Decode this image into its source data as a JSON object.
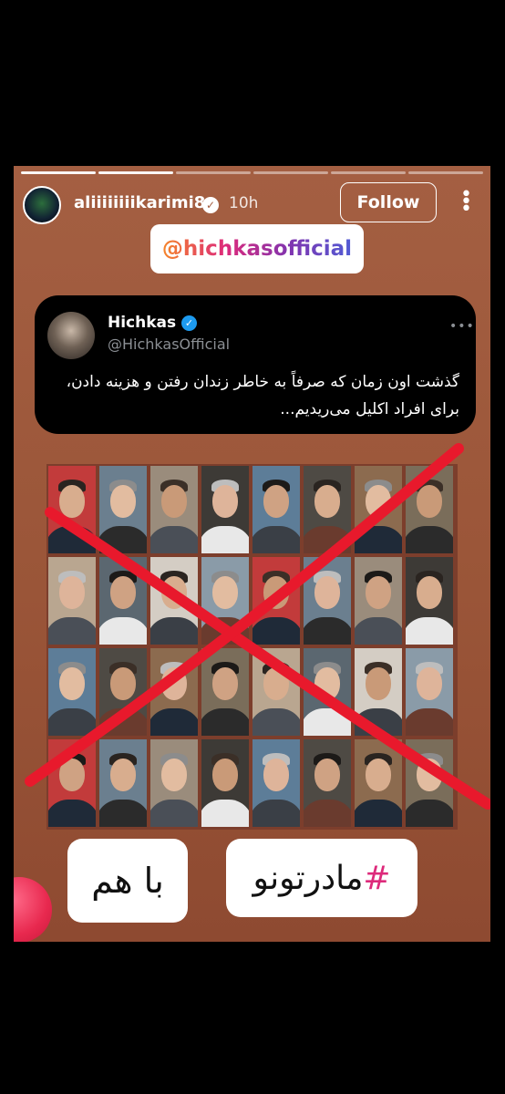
{
  "story": {
    "username": "aliiiiiiiikarimi8",
    "time": "10h",
    "follow_label": "Follow",
    "verified_icon": "verified-badge-icon",
    "progress_total": 6,
    "progress_done": 2
  },
  "mention": {
    "text": "@hichkasofficial"
  },
  "tweet": {
    "name": "Hichkas",
    "handle": "@HichkasOfficial",
    "text": "گذشت اون زمان که صرفاً به خاطر زندان رفتن و هزینه دادن، برای افراد اکلیل می‌ریدیم..."
  },
  "stickers": {
    "ba_ham": "با هم",
    "hashtag_symbol": "#",
    "hashtag_text": "مادرتونو"
  },
  "colors": {
    "story_bg": "#a45f42",
    "cross": "#e8192c",
    "tweet_bg": "#000000",
    "verified_blue": "#1d9bf0"
  }
}
